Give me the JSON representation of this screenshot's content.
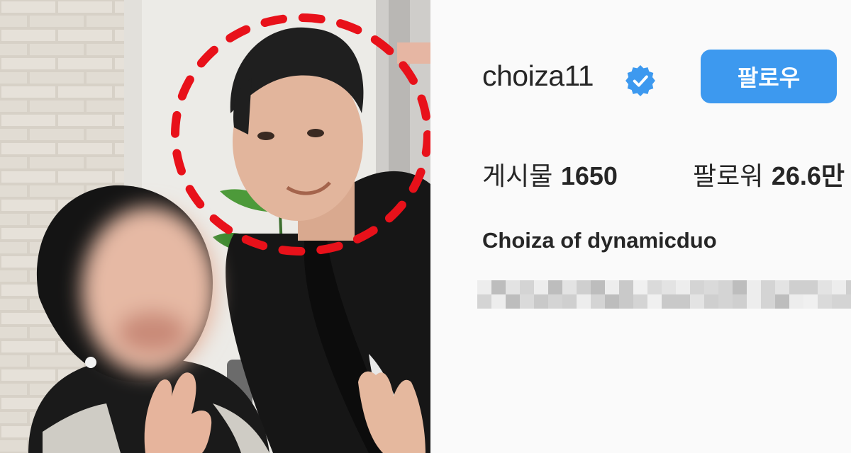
{
  "profile": {
    "username": "choiza11",
    "verified_icon": "verified-badge-icon",
    "follow_label": "팔로우",
    "stats": {
      "posts_label": "게시물",
      "posts_value": "1650",
      "followers_label": "팔로워",
      "followers_value": "26.6만"
    },
    "display_name": "Choiza of dynamicduo"
  },
  "colors": {
    "follow_button": "#3d99ef",
    "verified_badge": "#3d99ef",
    "annotation_circle": "#e8111a",
    "text": "#262626",
    "panel_bg": "#fafafa"
  }
}
